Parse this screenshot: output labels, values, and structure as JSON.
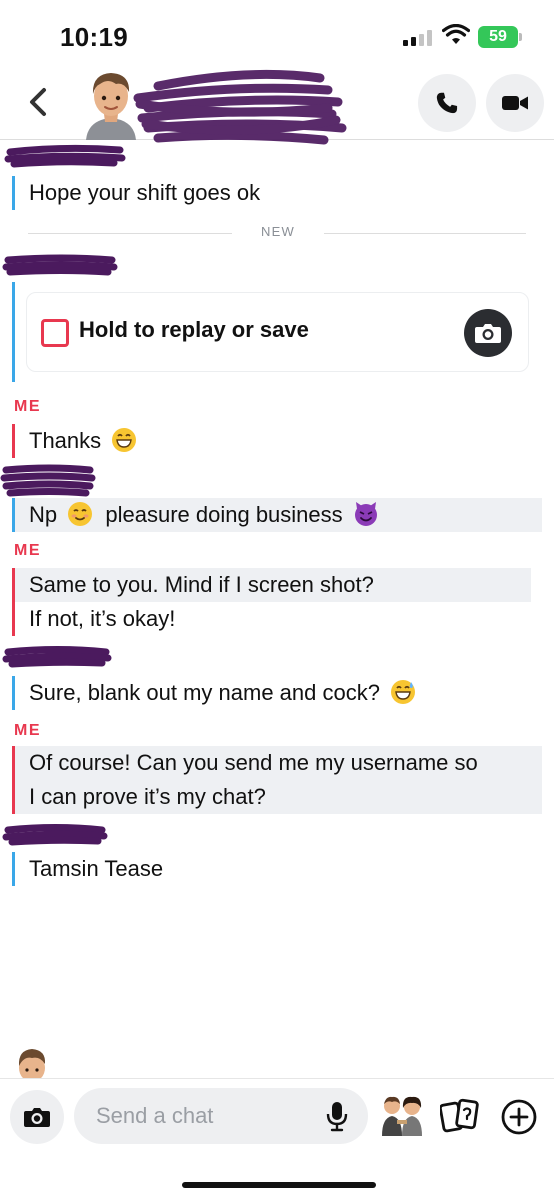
{
  "status_bar": {
    "time": "10:19",
    "battery": "59"
  },
  "header": {
    "contact_name_redacted": true
  },
  "chat": {
    "new_divider": "NEW",
    "me_label": "ME",
    "messages": [
      {
        "sender": "them",
        "text": "Hope your shift goes ok"
      },
      {
        "sender": "them",
        "type": "snap",
        "text": "Hold to replay or save"
      },
      {
        "sender": "me",
        "text": "Thanks"
      },
      {
        "sender": "them",
        "text": "Np",
        "text2": "pleasure doing business"
      },
      {
        "sender": "me",
        "line1": "Same to you. Mind if I screen shot?",
        "line2": "If not, it’s okay!"
      },
      {
        "sender": "them",
        "text": "Sure, blank out my name and cock?"
      },
      {
        "sender": "me",
        "line1": "Of course! Can you send me my username so",
        "line2": "I can prove it’s my chat?"
      },
      {
        "sender": "them",
        "text": "Tamsin Tease"
      }
    ]
  },
  "composer": {
    "placeholder": "Send a chat"
  },
  "colors": {
    "me_accent": "#e8384f",
    "them_accent": "#3aa7e8",
    "battery": "#34c759",
    "redaction": "#4b1a5e"
  },
  "icons": [
    "back-chevron-icon",
    "phone-icon",
    "video-icon",
    "camera-icon",
    "mic-icon",
    "bitmoji-icon",
    "cards-icon",
    "plus-icon"
  ]
}
